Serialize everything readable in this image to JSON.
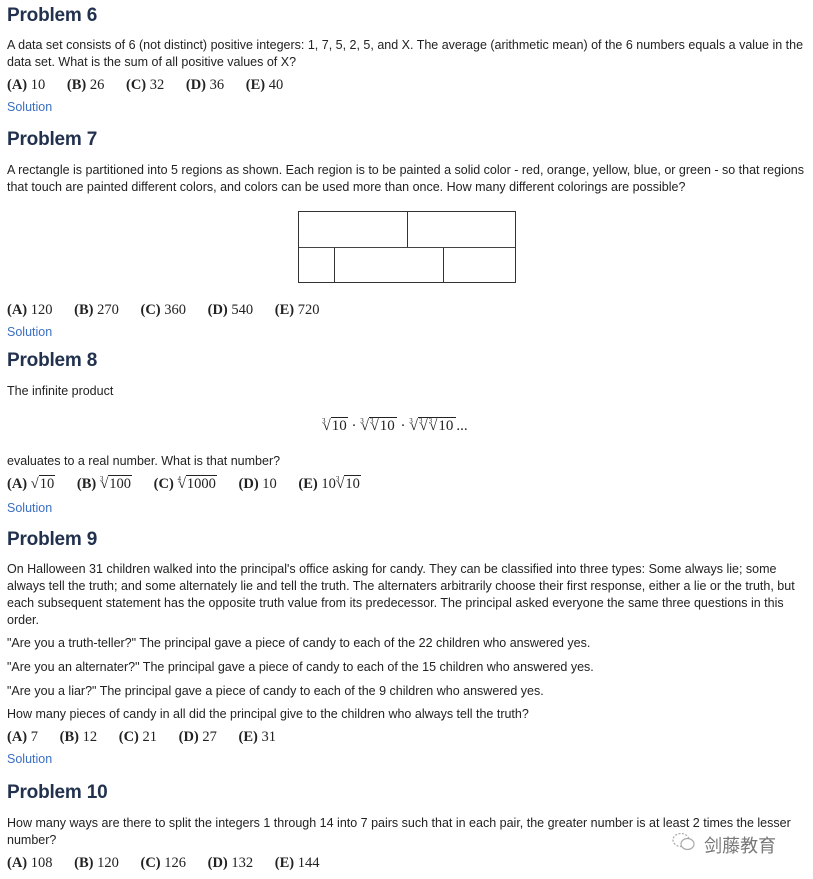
{
  "problems": [
    {
      "title": "Problem 6",
      "text": "A data set consists of 6 (not distinct) positive integers: 1, 7, 5, 2, 5, and X. The average (arithmetic mean) of the 6 numbers equals a value in the data set. What is the sum of all positive values of X?",
      "choices": [
        {
          "label": "(A)",
          "value": "10"
        },
        {
          "label": "(B)",
          "value": "26"
        },
        {
          "label": "(C)",
          "value": "32"
        },
        {
          "label": "(D)",
          "value": "36"
        },
        {
          "label": "(E)",
          "value": "40"
        }
      ],
      "solution_link": "Solution"
    },
    {
      "title": "Problem 7",
      "text": "A rectangle is partitioned into 5 regions as shown. Each region is to be painted a solid color - red, orange, yellow, blue, or green - so that regions that touch are painted different colors, and colors can be used more than once. How many different colorings are possible?",
      "choices": [
        {
          "label": "(A)",
          "value": "120"
        },
        {
          "label": "(B)",
          "value": "270"
        },
        {
          "label": "(C)",
          "value": "360"
        },
        {
          "label": "(D)",
          "value": "540"
        },
        {
          "label": "(E)",
          "value": "720"
        }
      ],
      "solution_link": "Solution"
    },
    {
      "title": "Problem 8",
      "intro": "The infinite product",
      "expression": {
        "radicand": "10",
        "index": "3",
        "ellipsis": "...",
        "dot": "·"
      },
      "text": "evaluates to a real number. What is that number?",
      "choices": [
        {
          "label": "(A)",
          "prefix": "",
          "index": "",
          "radicand": "10"
        },
        {
          "label": "(B)",
          "prefix": "",
          "index": "3",
          "radicand": "100"
        },
        {
          "label": "(C)",
          "prefix": "",
          "index": "4",
          "radicand": "1000"
        },
        {
          "label": "(D)",
          "value": "10"
        },
        {
          "label": "(E)",
          "prefix": "10",
          "index": "3",
          "radicand": "10"
        }
      ],
      "solution_link": "Solution"
    },
    {
      "title": "Problem 9",
      "text": "On Halloween 31 children walked into the principal's office asking for candy. They can be classified into three types: Some always lie; some always tell the truth; and some alternately lie and tell the truth. The alternaters arbitrarily choose their first response, either a lie or the truth, but each subsequent statement has the opposite truth value from its predecessor. The principal asked everyone the same three questions in this order.",
      "q1": "\"Are you a truth-teller?\" The principal gave a piece of candy to each of the 22 children who answered yes.",
      "q2": "\"Are you an alternater?\" The principal gave a piece of candy to each of the 15 children who answered yes.",
      "q3": "\"Are you a liar?\" The principal gave a piece of candy to each of the 9 children who answered yes.",
      "question": "How many pieces of candy in all did the principal give to the children who always tell the truth?",
      "choices": [
        {
          "label": "(A)",
          "value": "7"
        },
        {
          "label": "(B)",
          "value": "12"
        },
        {
          "label": "(C)",
          "value": "21"
        },
        {
          "label": "(D)",
          "value": "27"
        },
        {
          "label": "(E)",
          "value": "31"
        }
      ],
      "solution_link": "Solution"
    },
    {
      "title": "Problem 10",
      "text": "How many ways are there to split the integers 1 through 14 into 7 pairs such that in each pair, the greater number is at least 2 times the lesser number?",
      "choices": [
        {
          "label": "(A)",
          "value": "108"
        },
        {
          "label": "(B)",
          "value": "120"
        },
        {
          "label": "(C)",
          "value": "126"
        },
        {
          "label": "(D)",
          "value": "132"
        },
        {
          "label": "(E)",
          "value": "144"
        }
      ]
    }
  ],
  "watermark": {
    "icon": "wechat-icon",
    "text": "剑藤教育"
  }
}
